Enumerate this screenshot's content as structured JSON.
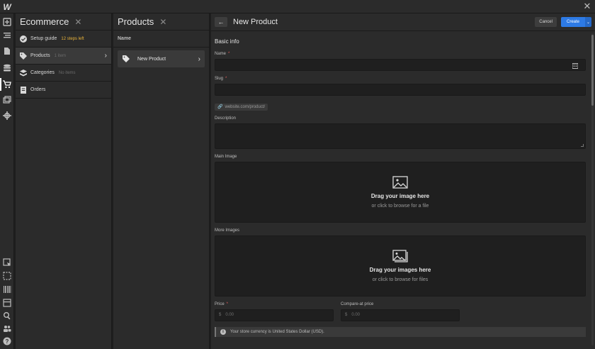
{
  "app": {
    "logo": "W",
    "close": "✕"
  },
  "rail": [
    "add",
    "navigator",
    "pages",
    "cms",
    "ecommerce",
    "assets",
    "settings",
    "select",
    "selection",
    "audit",
    "layout",
    "search",
    "users",
    "help"
  ],
  "ecommerce_panel": {
    "title": "Ecommerce",
    "close": "✕",
    "items": [
      {
        "label": "Setup guide",
        "meta": "12 steps left"
      },
      {
        "label": "Products",
        "meta": "1 item"
      },
      {
        "label": "Categories",
        "meta": "No items"
      },
      {
        "label": "Orders",
        "meta": ""
      }
    ]
  },
  "products_panel": {
    "title": "Products",
    "close": "✕",
    "column": "Name",
    "rows": [
      {
        "label": "New Product"
      }
    ]
  },
  "main": {
    "title": "New Product",
    "back": "←",
    "cancel": "Cancel",
    "create": "Create",
    "create_dropdown": "⌄",
    "section": "Basic info",
    "fields": {
      "name": {
        "label": "Name",
        "value": ""
      },
      "slug": {
        "label": "Slug",
        "value": "",
        "hint": "website.com/product/"
      },
      "description": {
        "label": "Description",
        "value": ""
      },
      "main_image": {
        "label": "Main Image",
        "title": "Drag your image here",
        "sub": "or click to browse for a file"
      },
      "more_images": {
        "label": "More Images",
        "title": "Drag your images here",
        "sub": "or click to browse for files"
      },
      "price": {
        "label": "Price",
        "currency": "$",
        "placeholder": "0.00"
      },
      "compare_price": {
        "label": "Compare-at price",
        "currency": "$",
        "placeholder": "0.00"
      }
    },
    "currency_note": "Your store currency is United States Dollar (USD).",
    "required_mark": "*"
  },
  "colors": {
    "accent": "#2d7ae5",
    "warn": "#e8b33a",
    "required": "#e05a5a"
  }
}
